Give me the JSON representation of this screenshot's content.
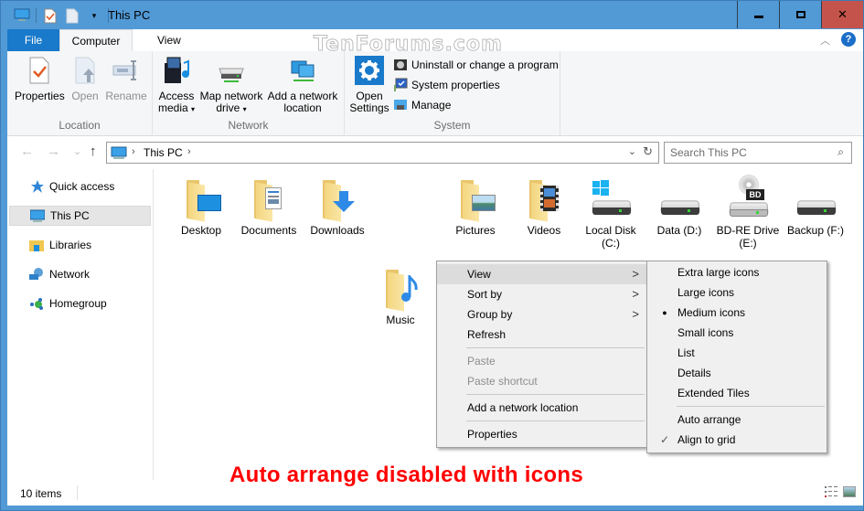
{
  "window": {
    "title": "This PC",
    "controls": {
      "minimize": "–",
      "maximize": "☐",
      "close": "✕"
    },
    "watermark": "TenForums.com"
  },
  "quick_access_toolbar": {
    "icons": [
      "this-pc-icon",
      "properties-icon",
      "new-folder-icon",
      "customize-dropdown-icon"
    ]
  },
  "ribbon": {
    "tabs": [
      {
        "label": "File",
        "active": false
      },
      {
        "label": "Computer",
        "active": true
      },
      {
        "label": "View",
        "active": false
      }
    ],
    "groups": {
      "location": {
        "label": "Location",
        "buttons": [
          {
            "label": "Properties",
            "enabled": true
          },
          {
            "label": "Open",
            "enabled": false
          },
          {
            "label": "Rename",
            "enabled": false
          }
        ]
      },
      "network": {
        "label": "Network",
        "buttons": [
          {
            "line1": "Access",
            "line2": "media",
            "dropdown": true
          },
          {
            "line1": "Map network",
            "line2": "drive",
            "dropdown": true
          },
          {
            "line1": "Add a network",
            "line2": "location",
            "dropdown": false
          }
        ]
      },
      "system": {
        "label": "System",
        "open_settings": {
          "line1": "Open",
          "line2": "Settings"
        },
        "small_buttons": [
          {
            "label": "Uninstall or change a program"
          },
          {
            "label": "System properties"
          },
          {
            "label": "Manage"
          }
        ]
      }
    }
  },
  "navigation": {
    "back": "←",
    "forward": "→",
    "recent": "⌄",
    "up": "↑",
    "breadcrumb": [
      "This PC"
    ],
    "search_placeholder": "Search This PC"
  },
  "nav_pane": {
    "items": [
      {
        "label": "Quick access",
        "selected": false
      },
      {
        "label": "This PC",
        "selected": true
      },
      {
        "label": "Libraries",
        "selected": false
      },
      {
        "label": "Network",
        "selected": false
      },
      {
        "label": "Homegroup",
        "selected": false
      }
    ]
  },
  "items": [
    {
      "name": "Desktop",
      "type": "folder"
    },
    {
      "name": "Documents",
      "type": "folder"
    },
    {
      "name": "Downloads",
      "type": "folder"
    },
    {
      "name": "Pictures",
      "type": "folder"
    },
    {
      "name": "Videos",
      "type": "folder"
    },
    {
      "name": "Local Disk (C:)",
      "line1": "Local Disk",
      "line2": "(C:)",
      "type": "drive"
    },
    {
      "name": "Data (D:)",
      "type": "drive"
    },
    {
      "name": "BD-RE Drive (E:)",
      "line1": "BD-RE Drive",
      "line2": "(E:)",
      "type": "optical",
      "badge": "BD"
    },
    {
      "name": "Backup (F:)",
      "type": "drive"
    },
    {
      "name": "Music",
      "type": "folder"
    }
  ],
  "context_menu": {
    "items": [
      {
        "label": "View",
        "submenu": true,
        "highlighted": true
      },
      {
        "label": "Sort by",
        "submenu": true
      },
      {
        "label": "Group by",
        "submenu": true
      },
      {
        "label": "Refresh"
      },
      {
        "label": "Paste",
        "enabled": false
      },
      {
        "label": "Paste shortcut",
        "enabled": false
      },
      {
        "label": "Add a network location"
      },
      {
        "label": "Properties"
      }
    ],
    "submenu_arrow": ">"
  },
  "view_submenu": {
    "items": [
      {
        "label": "Extra large icons"
      },
      {
        "label": "Large icons"
      },
      {
        "label": "Medium icons",
        "selected": true
      },
      {
        "label": "Small icons"
      },
      {
        "label": "List"
      },
      {
        "label": "Details"
      },
      {
        "label": "Extended Tiles"
      },
      {
        "label": "Auto arrange",
        "checked": false
      },
      {
        "label": "Align to grid",
        "checked": true
      }
    ],
    "radio_mark": "●",
    "check_mark": "✓"
  },
  "status_bar": {
    "item_count": "10 items"
  },
  "caption": "Auto arrange disabled with icons",
  "colors": {
    "titlebar": "#529ad6",
    "file_tab": "#1979ca",
    "close_button": "#c4544b",
    "caption": "#ff0000"
  }
}
